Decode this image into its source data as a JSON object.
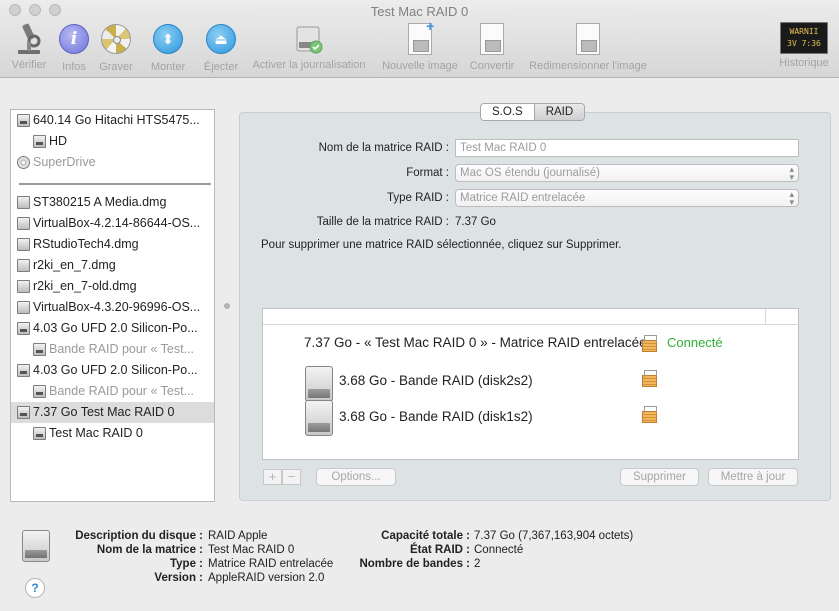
{
  "window": {
    "title": "Test Mac RAID 0"
  },
  "toolbar": {
    "verify": "Vérifier",
    "info": "Infos",
    "burn": "Graver",
    "mount": "Monter",
    "eject": "Éjecter",
    "journal": "Activer la journalisation",
    "new_image": "Nouvelle image",
    "convert": "Convertir",
    "resize": "Redimensionner l'image",
    "log": "Historique",
    "log_icon_text": [
      "WARNII",
      "3V 7:36"
    ]
  },
  "sidebar": {
    "items": [
      {
        "label": "640.14 Go Hitachi HTS5475..."
      },
      {
        "label": "HD"
      },
      {
        "label": "SuperDrive"
      },
      {
        "label": "ST380215 A Media.dmg"
      },
      {
        "label": "VirtualBox-4.2.14-86644-OS..."
      },
      {
        "label": "RStudioTech4.dmg"
      },
      {
        "label": "r2ki_en_7.dmg"
      },
      {
        "label": "r2ki_en_7-old.dmg"
      },
      {
        "label": "VirtualBox-4.3.20-96996-OS..."
      },
      {
        "label": "4.03 Go UFD 2.0 Silicon-Po..."
      },
      {
        "label": "Bande RAID pour « Test..."
      },
      {
        "label": "4.03 Go UFD 2.0 Silicon-Po..."
      },
      {
        "label": "Bande RAID pour « Test..."
      },
      {
        "label": "7.37 Go Test Mac RAID 0"
      },
      {
        "label": "Test Mac RAID 0"
      }
    ]
  },
  "tabs": [
    {
      "label": "S.O.S"
    },
    {
      "label": "RAID"
    }
  ],
  "form": {
    "name_label": "Nom de la matrice RAID :",
    "name_value": "Test Mac RAID 0",
    "format_label": "Format :",
    "format_value": "Mac OS étendu (journalisé)",
    "type_label": "Type RAID :",
    "type_value": "Matrice RAID entrelacée",
    "size_label": "Taille de la matrice RAID :",
    "size_value": "7.37 Go",
    "note": "Pour supprimer une matrice RAID sélectionnée, cliquez sur Supprimer."
  },
  "raid_list": {
    "set": "7.37 Go - « Test Mac RAID 0 » - Matrice RAID entrelacée",
    "status": "Connecté",
    "members": [
      {
        "label": "3.68 Go - Bande RAID (disk2s2)"
      },
      {
        "label": "3.68 Go - Bande RAID (disk1s2)"
      }
    ]
  },
  "buttons": {
    "add": "+",
    "remove": "−",
    "options": "Options...",
    "delete": "Supprimer",
    "update": "Mettre à jour"
  },
  "info": {
    "desc_label": "Description du disque :",
    "desc_value": "RAID Apple",
    "name_label": "Nom de la matrice :",
    "name_value": "Test Mac RAID 0",
    "type_label": "Type :",
    "type_value": "Matrice RAID entrelacée",
    "version_label": "Version :",
    "version_value": "AppleRAID version 2.0",
    "capacity_label": "Capacité totale :",
    "capacity_value": "7.37 Go (7,367,163,904 octets)",
    "state_label": "État RAID :",
    "state_value": "Connecté",
    "bands_label": "Nombre de bandes :",
    "bands_value": "2",
    "help": "?"
  },
  "colors": {
    "connected": "#2fae3b",
    "selected_row": "#dcdcdc",
    "panel": "#dde2e4"
  }
}
